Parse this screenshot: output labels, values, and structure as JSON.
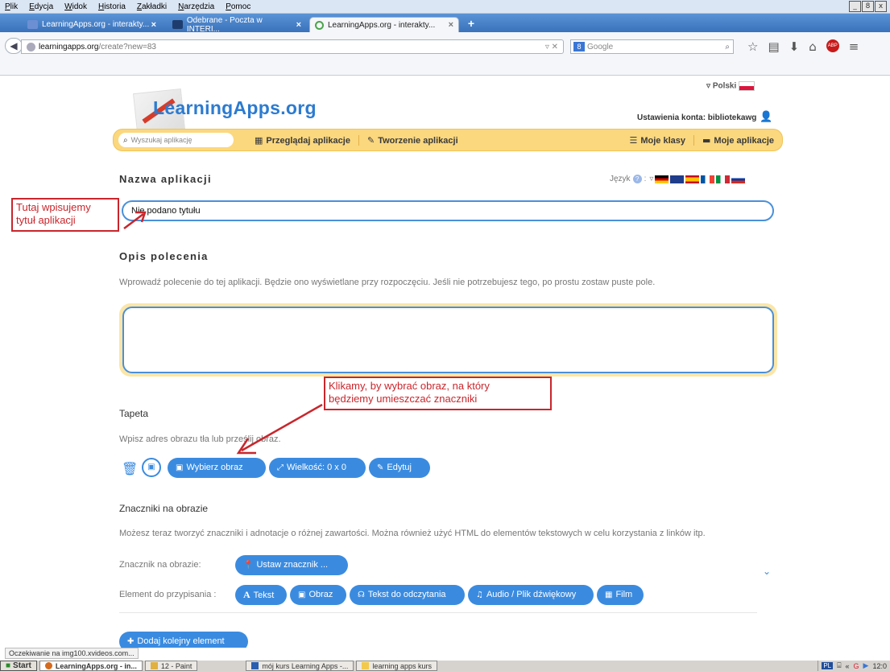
{
  "menubar": {
    "items": [
      "Plik",
      "Edycja",
      "Widok",
      "Historia",
      "Zakładki",
      "Narzędzia",
      "Pomoc"
    ],
    "window_buttons": [
      "_",
      "8",
      "x"
    ]
  },
  "tabs": [
    {
      "label": "LearningApps.org - interakty...",
      "close": "×"
    },
    {
      "label": "Odebrane - Poczta w INTERI...",
      "close": "×"
    },
    {
      "label": "LearningApps.org - interakty...",
      "close": "×"
    }
  ],
  "new_tab": "+",
  "urlbar": {
    "host": "learningapps.org",
    "path": "/create?new=83",
    "controls": "▿ ✕"
  },
  "search": {
    "placeholder": "Google",
    "engine": "8"
  },
  "site": {
    "logo": "LearningApps.org",
    "language": "Polski",
    "account_label": "Ustawienia konta: bibliotekawg"
  },
  "nav": {
    "search_placeholder": "Wyszukaj aplikację",
    "browse": "Przeglądaj aplikacje",
    "create": "Tworzenie aplikacji",
    "classes": "Moje klasy",
    "apps": "Moje aplikacje"
  },
  "form": {
    "app_name_heading": "Nazwa aplikacji",
    "language_label": "Język",
    "title_value": "Nie podano tytułu",
    "task_heading": "Opis polecenia",
    "task_hint": "Wprowadź polecenie do tej aplikacji. Będzie ono wyświetlane przy rozpoczęciu. Jeśli nie potrzebujesz tego, po prostu zostaw puste pole.",
    "wallpaper_heading": "Tapeta",
    "wallpaper_hint": "Wpisz adres obrazu tła lub prześlij obraz.",
    "choose_image": "Wybierz obraz",
    "size": "Wielkość: 0 x 0",
    "edit": "Edytuj",
    "markers_heading": "Znaczniki na obrazie",
    "markers_hint": "Możesz teraz tworzyć znaczniki i adnotacje o różnej zawartości. Można również użyć HTML do elementów tekstowych w celu korzystania z linków itp.",
    "marker_label": "Znacznik na obrazie:",
    "set_marker": "Ustaw znacznik ...",
    "element_label": "Element do przypisania :",
    "el_text": "Tekst",
    "el_image": "Obraz",
    "el_read": "Tekst do odczytania",
    "el_audio": "Audio / Plik dźwiękowy",
    "el_film": "Film",
    "add_element": "Dodaj kolejny element"
  },
  "annotations": {
    "title_note": "Tutaj wpisujemy\ntytuł aplikacji",
    "image_note": "Klikamy, by wybrać obraz, na który\nbędziemy umieszczać znaczniki"
  },
  "status": "Oczekiwanie na img100.xvideos.com...",
  "taskbar": {
    "start": "Start",
    "items": [
      "LearningApps.org - in...",
      "12 - Paint",
      "mój kurs Learning Apps -...",
      "learning apps kurs"
    ],
    "lang": "PL",
    "time": "12:0"
  },
  "colors": {
    "accent": "#3a8be0",
    "nav_bg": "#fbd87e",
    "annotation": "#c9262c"
  }
}
